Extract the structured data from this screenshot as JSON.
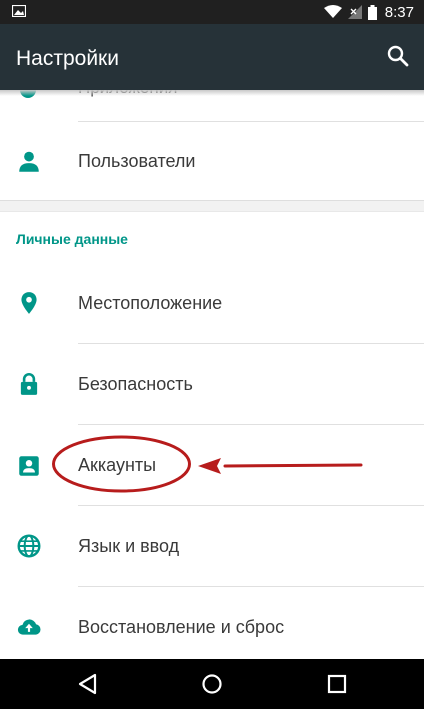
{
  "status_bar": {
    "time": "8:37",
    "icons": [
      "image-icon",
      "wifi-icon",
      "signal-icon",
      "battery-icon"
    ]
  },
  "app_bar": {
    "title": "Настройки",
    "search_icon": "search-icon"
  },
  "top_partial": {
    "text": "Приложения"
  },
  "items_top": [
    {
      "label": "Пользователи",
      "icon": "person-icon"
    }
  ],
  "section": {
    "header": "Личные данные"
  },
  "items": [
    {
      "label": "Местоположение",
      "icon": "location-icon"
    },
    {
      "label": "Безопасность",
      "icon": "lock-icon"
    },
    {
      "label": "Аккаунты",
      "icon": "account-box-icon"
    },
    {
      "label": "Язык и ввод",
      "icon": "globe-icon"
    },
    {
      "label": "Восстановление и сброс",
      "icon": "cloud-upload-icon"
    }
  ],
  "colors": {
    "accent": "#009688",
    "app_bar": "#263238",
    "status_bar": "#202020",
    "annotation": "#b71c1c"
  },
  "nav_bar": {
    "icons": [
      "back-icon",
      "home-icon",
      "recents-icon"
    ]
  }
}
